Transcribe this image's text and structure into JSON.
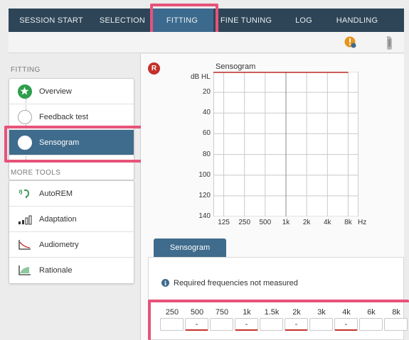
{
  "topnav": {
    "tabs": [
      {
        "label": "SESSION START"
      },
      {
        "label": "SELECTION"
      },
      {
        "label": "FITTING",
        "active": true
      },
      {
        "label": "FINE TUNING"
      },
      {
        "label": "LOG"
      },
      {
        "label": "HANDLING"
      }
    ]
  },
  "toolbar": {
    "icons": [
      "warning-info-icon",
      "hearing-aid-device-icon"
    ]
  },
  "sidebar": {
    "fitting_title": "FITTING",
    "steps": [
      {
        "label": "Overview",
        "state": "done"
      },
      {
        "label": "Feedback test",
        "state": "pending"
      },
      {
        "label": "Sensogram",
        "state": "selected"
      }
    ],
    "more_tools_title": "MORE TOOLS",
    "tools": [
      {
        "label": "AutoREM",
        "icon": "ear-sound-icon"
      },
      {
        "label": "Adaptation",
        "icon": "signal-bars-icon"
      },
      {
        "label": "Audiometry",
        "icon": "audiogram-icon"
      },
      {
        "label": "Rationale",
        "icon": "rationale-icon"
      }
    ]
  },
  "main": {
    "side_badge": "R",
    "side_color": "#c4302b",
    "subtab_label": "Sensogram",
    "info_icon_glyph": "i",
    "info_text": "Required frequencies not measured",
    "frequencies": [
      {
        "label": "250",
        "value": "",
        "required": false
      },
      {
        "label": "500",
        "value": "-",
        "required": true
      },
      {
        "label": "750",
        "value": "",
        "required": false
      },
      {
        "label": "1k",
        "value": "-",
        "required": true
      },
      {
        "label": "1.5k",
        "value": "",
        "required": false
      },
      {
        "label": "2k",
        "value": "-",
        "required": true
      },
      {
        "label": "3k",
        "value": "",
        "required": false
      },
      {
        "label": "4k",
        "value": "-",
        "required": true
      },
      {
        "label": "6k",
        "value": "",
        "required": false
      },
      {
        "label": "8k",
        "value": "",
        "required": false
      }
    ]
  },
  "chart_data": {
    "type": "line",
    "title": "Sensogram",
    "ylabel": "dB HL",
    "xlabel": "Hz",
    "x_ticks": [
      "125",
      "250",
      "500",
      "1k",
      "2k",
      "4k",
      "8k"
    ],
    "y_ticks": [
      "20",
      "40",
      "60",
      "80",
      "100",
      "120",
      "140"
    ],
    "ylim": [
      0,
      140
    ],
    "y_inverted": true,
    "x_scale": "log",
    "grid": true,
    "series": []
  },
  "colors": {
    "nav_bg": "#2e4557",
    "accent": "#3f6b8c",
    "highlight": "#e6537a",
    "done_green": "#2e9e4c"
  }
}
